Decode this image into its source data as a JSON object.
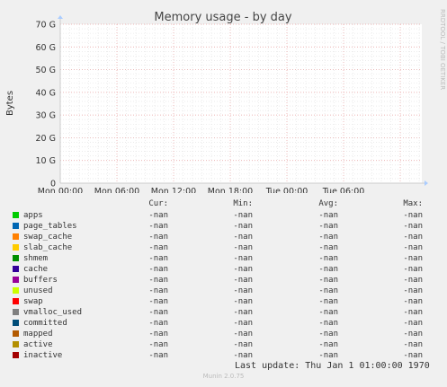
{
  "chart_data": {
    "type": "area",
    "title": "Memory usage - by day",
    "ylabel": "Bytes",
    "xlabel": "",
    "ylim": [
      0,
      70
    ],
    "y_unit": "G",
    "y_ticks": [
      "0",
      "10 G",
      "20 G",
      "30 G",
      "40 G",
      "50 G",
      "60 G",
      "70 G"
    ],
    "y_tick_values": [
      0,
      10,
      20,
      30,
      40,
      50,
      60,
      70
    ],
    "x_ticks": [
      "Mon 00:00",
      "Mon 06:00",
      "Mon 12:00",
      "Mon 18:00",
      "Tue 00:00",
      "Tue 06:00"
    ],
    "grid": true,
    "series": [
      {
        "name": "apps",
        "color": "#00cc00",
        "cur": "-nan",
        "min": "-nan",
        "avg": "-nan",
        "max": "-nan"
      },
      {
        "name": "page_tables",
        "color": "#0066b3",
        "cur": "-nan",
        "min": "-nan",
        "avg": "-nan",
        "max": "-nan"
      },
      {
        "name": "swap_cache",
        "color": "#ff8000",
        "cur": "-nan",
        "min": "-nan",
        "avg": "-nan",
        "max": "-nan"
      },
      {
        "name": "slab_cache",
        "color": "#ffcc00",
        "cur": "-nan",
        "min": "-nan",
        "avg": "-nan",
        "max": "-nan"
      },
      {
        "name": "shmem",
        "color": "#008f00",
        "cur": "-nan",
        "min": "-nan",
        "avg": "-nan",
        "max": "-nan"
      },
      {
        "name": "cache",
        "color": "#330099",
        "cur": "-nan",
        "min": "-nan",
        "avg": "-nan",
        "max": "-nan"
      },
      {
        "name": "buffers",
        "color": "#990099",
        "cur": "-nan",
        "min": "-nan",
        "avg": "-nan",
        "max": "-nan"
      },
      {
        "name": "unused",
        "color": "#ccff00",
        "cur": "-nan",
        "min": "-nan",
        "avg": "-nan",
        "max": "-nan"
      },
      {
        "name": "swap",
        "color": "#ff0000",
        "cur": "-nan",
        "min": "-nan",
        "avg": "-nan",
        "max": "-nan"
      },
      {
        "name": "vmalloc_used",
        "color": "#808080",
        "cur": "-nan",
        "min": "-nan",
        "avg": "-nan",
        "max": "-nan"
      },
      {
        "name": "committed",
        "color": "#004d79",
        "cur": "-nan",
        "min": "-nan",
        "avg": "-nan",
        "max": "-nan"
      },
      {
        "name": "mapped",
        "color": "#b35a00",
        "cur": "-nan",
        "min": "-nan",
        "avg": "-nan",
        "max": "-nan"
      },
      {
        "name": "active",
        "color": "#b38f00",
        "cur": "-nan",
        "min": "-nan",
        "avg": "-nan",
        "max": "-nan"
      },
      {
        "name": "inactive",
        "color": "#a30000",
        "cur": "-nan",
        "min": "-nan",
        "avg": "-nan",
        "max": "-nan"
      }
    ]
  },
  "legend_headers": {
    "cur": "Cur:",
    "min": "Min:",
    "avg": "Avg:",
    "max": "Max:"
  },
  "footer": {
    "last_update": "Last update: Thu Jan  1 01:00:00 1970",
    "munin_version": "Munin 2.0.75",
    "side_label": "RRDTOOL / TOBI OETIKER"
  }
}
